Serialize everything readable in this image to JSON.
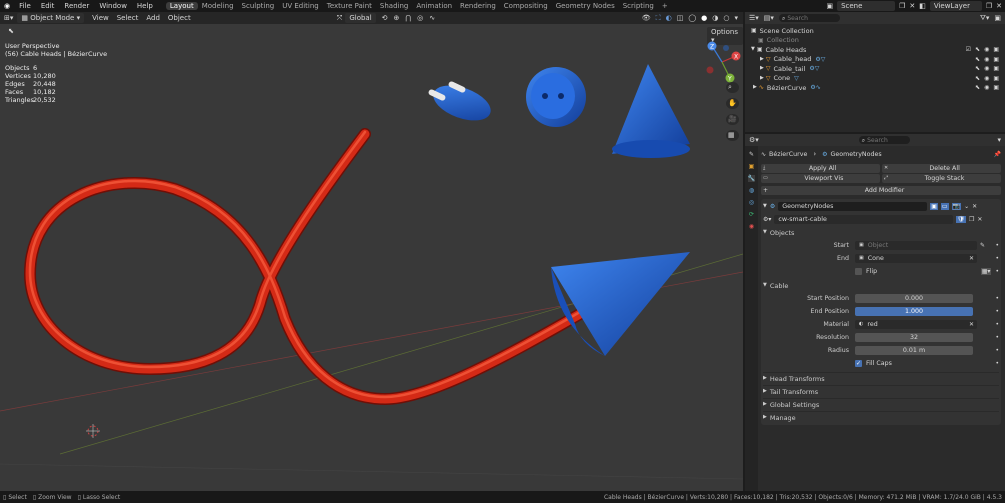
{
  "topbar": {
    "menus": [
      "File",
      "Edit",
      "Render",
      "Window",
      "Help"
    ],
    "tabs": [
      "Layout",
      "Modeling",
      "Sculpting",
      "UV Editing",
      "Texture Paint",
      "Shading",
      "Animation",
      "Rendering",
      "Compositing",
      "Geometry Nodes",
      "Scripting"
    ],
    "active_tab": "Layout",
    "add_tab": "+",
    "scene": "Scene",
    "view_layer": "ViewLayer"
  },
  "viewport_header": {
    "mode": "Object Mode",
    "menus": [
      "View",
      "Select",
      "Add",
      "Object"
    ],
    "transform_orientation": "Global",
    "options": "Options"
  },
  "overlay": {
    "view_name": "User Perspective",
    "collection_info": "(56) Cable Heads | BézierCurve",
    "stats": [
      {
        "label": "Objects",
        "value": "6"
      },
      {
        "label": "Vertices",
        "value": "10,280"
      },
      {
        "label": "Edges",
        "value": "20,448"
      },
      {
        "label": "Faces",
        "value": "10,182"
      },
      {
        "label": "Triangles",
        "value": "20,532"
      }
    ]
  },
  "gizmo_axes": {
    "x": "X",
    "y": "Y",
    "z": "Z"
  },
  "outliner": {
    "search_placeholder": "Search",
    "items": [
      {
        "label": "Scene Collection",
        "indent": 0
      },
      {
        "label": "Collection",
        "indent": 1,
        "dim": true
      },
      {
        "label": "Cable Heads",
        "indent": 1
      },
      {
        "label": "Cable_head",
        "indent": 2
      },
      {
        "label": "Cable_tail",
        "indent": 2
      },
      {
        "label": "Cone",
        "indent": 2
      },
      {
        "label": "BézierCurve",
        "indent": 1
      }
    ]
  },
  "properties": {
    "search_placeholder": "Search",
    "breadcrumb_object": "BézierCurve",
    "breadcrumb_modifier": "GeometryNodes",
    "apply_all": "Apply All",
    "delete_all": "Delete All",
    "viewport_vis": "Viewport Vis",
    "toggle_stack": "Toggle Stack",
    "add_modifier": "Add Modifier",
    "modifier_name": "GeometryNodes",
    "node_group": "cw-smart-cable",
    "objects_panel": "Objects",
    "start_label": "Start",
    "start_placeholder": "Object",
    "end_label": "End",
    "end_value": "Cone",
    "flip_label": "Flip",
    "cable_panel": "Cable",
    "start_position_label": "Start Position",
    "start_position_value": "0.000",
    "end_position_label": "End Position",
    "end_position_value": "1.000",
    "material_label": "Material",
    "material_value": "red",
    "resolution_label": "Resolution",
    "resolution_value": "32",
    "radius_label": "Radius",
    "radius_value": "0.01 m",
    "fill_caps_label": "Fill Caps",
    "collapsed_panels": [
      "Head Transforms",
      "Tail Transforms",
      "Global Settings",
      "Manage"
    ]
  },
  "statusbar": {
    "select": "Select",
    "zoom_view": "Zoom View",
    "lasso_select": "Lasso Select",
    "stats": "Cable Heads | BézierCurve | Verts:10,280 | Faces:10,182 | Tris:20,532 | Objects:0/6 | Memory: 471.2 MiB | VRAM: 1.7/24.0 GiB | 4.5.3"
  },
  "colors": {
    "cable_red": "#d42a16",
    "head_blue": "#1d5fd6",
    "accent_blue": "#4772b3"
  }
}
